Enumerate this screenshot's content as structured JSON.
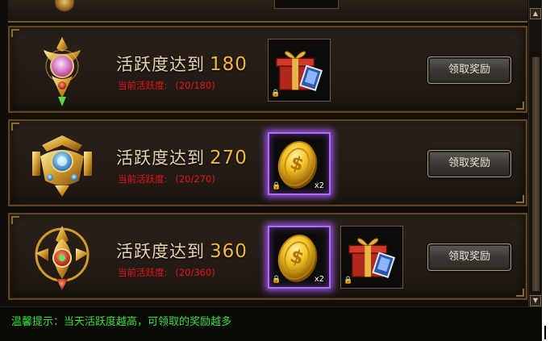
{
  "rows": [
    {
      "title_prefix": "活跃度达到",
      "target": "180",
      "progress_label": "当前活跃度:",
      "progress_value": "(20/180)",
      "button": "领取奖励",
      "rewards": [
        {
          "icon": "gift-box-icon",
          "qty": ""
        }
      ]
    },
    {
      "title_prefix": "活跃度达到",
      "target": "270",
      "progress_label": "当前活跃度:",
      "progress_value": "(20/270)",
      "button": "领取奖励",
      "rewards": [
        {
          "icon": "gold-coin-icon",
          "qty": "x2"
        }
      ]
    },
    {
      "title_prefix": "活跃度达到",
      "target": "360",
      "progress_label": "当前活跃度:",
      "progress_value": "(20/360)",
      "button": "领取奖励",
      "rewards": [
        {
          "icon": "gold-coin-icon",
          "qty": "x2"
        },
        {
          "icon": "gift-box-icon",
          "qty": ""
        }
      ]
    }
  ],
  "footer": {
    "tip": "温馨提示：当天活跃度越高，可领取的奖励越多"
  },
  "colors": {
    "progress_red": "#e4141a",
    "number_gold": "#f2b640",
    "tip_green": "#33e23a",
    "item_glow": "#b26bff"
  },
  "icons": [
    "lock-icon",
    "scroll-up-icon",
    "scroll-down-icon",
    "emblem-icon"
  ]
}
